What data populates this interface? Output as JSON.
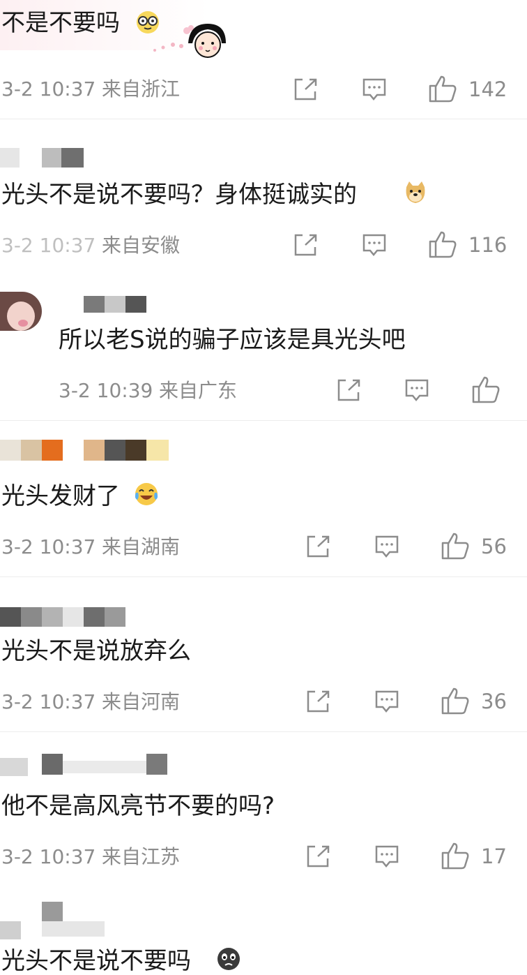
{
  "comments": [
    {
      "text": "不是不要吗",
      "emoji": "nerd-glasses-emoji",
      "time": "3-2 10:37",
      "location": "来自浙江",
      "likes": "142",
      "sticker": "girl-sticker"
    },
    {
      "text": "光头不是说不要吗？身体挺诚实的",
      "emoji": "doge-emoji",
      "time": "3-2 10:37",
      "location": "来自安徽",
      "likes": "116"
    },
    {
      "text": "所以老S说的骗子应该是具光头吧",
      "time": "3-2 10:39",
      "location": "来自广东",
      "likes": "",
      "avatar": "user-avatar"
    },
    {
      "text": "光头发财了",
      "emoji": "laugh-cry-emoji",
      "time": "3-2 10:37",
      "location": "来自湖南",
      "likes": "56"
    },
    {
      "text": "光头不是说放弃么",
      "time": "3-2 10:37",
      "location": "来自河南",
      "likes": "36"
    },
    {
      "text": "他不是高风亮节不要的吗?",
      "time": "3-2 10:37",
      "location": "来自江苏",
      "likes": "17"
    },
    {
      "text": "光头不是说不要吗",
      "emoji": "crying-face-emoji"
    }
  ],
  "icons": {
    "share": "share-icon",
    "comment": "comment-icon",
    "like": "thumbs-up-icon"
  },
  "colors": {
    "meta_gray": "#8c8c8c",
    "text": "#1a1a1a",
    "divider": "#ececec"
  }
}
